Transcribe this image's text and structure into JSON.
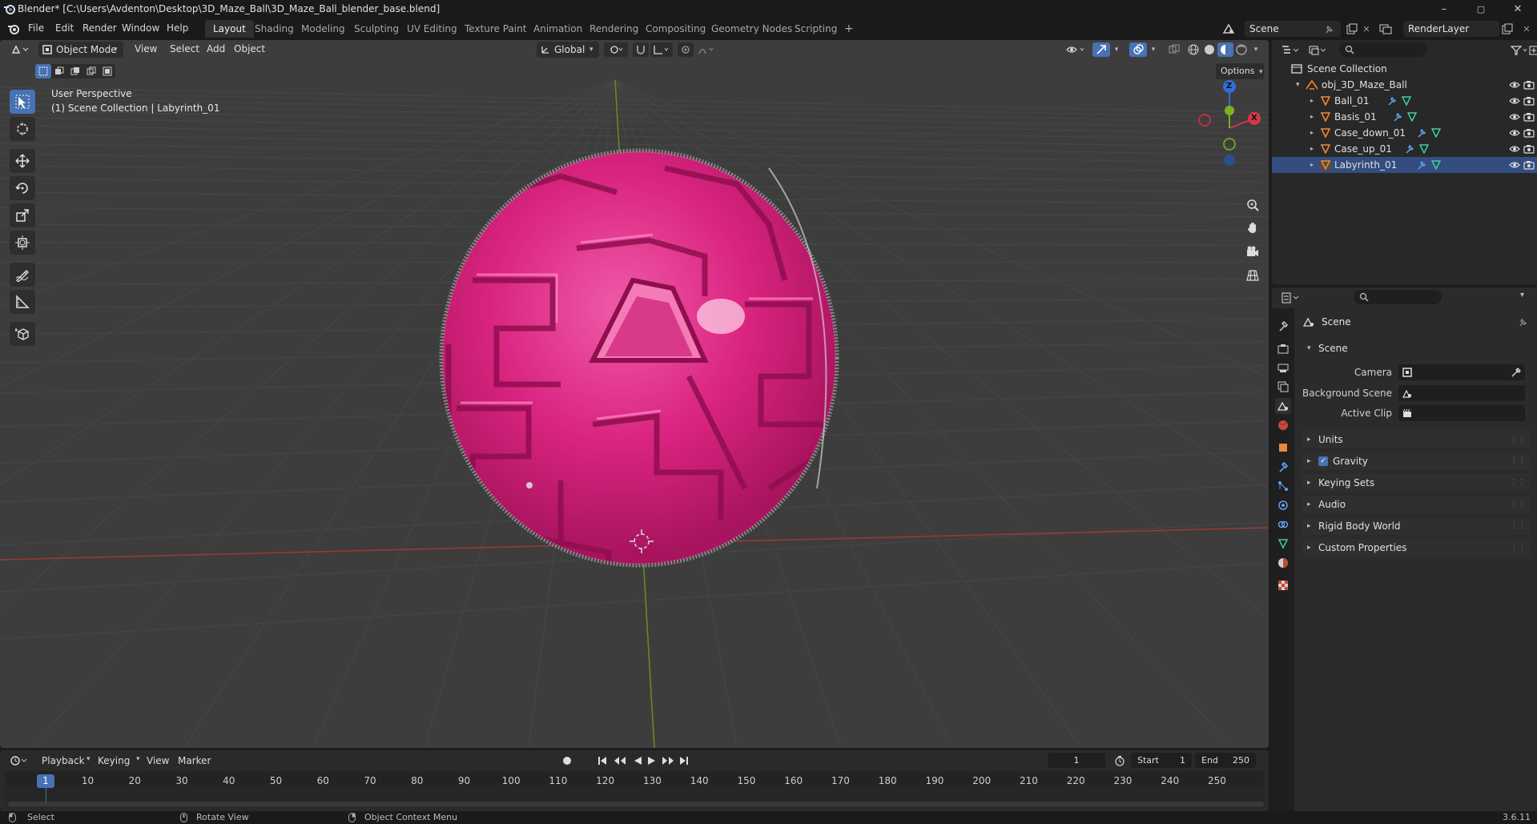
{
  "window": {
    "title": "Blender* [C:\\Users\\Avdenton\\Desktop\\3D_Maze_Ball\\3D_Maze_Ball_blender_base.blend]",
    "minimize": "–",
    "maximize": "▢",
    "close": "✕"
  },
  "menu": {
    "file": "File",
    "edit": "Edit",
    "render": "Render",
    "window": "Window",
    "help": "Help"
  },
  "workspaces": [
    "Layout",
    "Shading",
    "Modeling",
    "Sculpting",
    "UV Editing",
    "Texture Paint",
    "Animation",
    "Rendering",
    "Compositing",
    "Geometry Nodes",
    "Scripting"
  ],
  "workspace_add": "+",
  "scene_field": "Scene",
  "view_layer_field": "RenderLayer",
  "viewport": {
    "mode": "Object Mode",
    "menus": {
      "view": "View",
      "select": "Select",
      "add": "Add",
      "object": "Object"
    },
    "orientation": "Global",
    "options": "Options",
    "overlay_line1": "User Perspective",
    "overlay_line2": "(1) Scene Collection | Labyrinth_01",
    "gizmo": {
      "z": "Z",
      "x": "X"
    }
  },
  "outliner": {
    "root": "Scene Collection",
    "collection": "obj_3D_Maze_Ball",
    "objects": [
      "Ball_01",
      "Basis_01",
      "Case_down_01",
      "Case_up_01",
      "Labyrinth_01"
    ]
  },
  "properties": {
    "context": "Scene",
    "scene_panel": "Scene",
    "camera_label": "Camera",
    "background_label": "Background Scene",
    "clip_label": "Active Clip",
    "panels": [
      "Units",
      "Gravity",
      "Keying Sets",
      "Audio",
      "Rigid Body World",
      "Custom Properties"
    ]
  },
  "timeline": {
    "menus": {
      "playback": "Playback",
      "keying": "Keying",
      "view": "View",
      "marker": "Marker"
    },
    "current_frame": "1",
    "start_label": "Start",
    "start": "1",
    "end_label": "End",
    "end": "250",
    "ticks": [
      "1",
      "10",
      "20",
      "30",
      "40",
      "50",
      "60",
      "70",
      "80",
      "90",
      "100",
      "110",
      "120",
      "130",
      "140",
      "150",
      "160",
      "170",
      "180",
      "190",
      "200",
      "210",
      "220",
      "230",
      "240",
      "250"
    ]
  },
  "status": {
    "select": "Select",
    "rotate": "Rotate View",
    "context_menu": "Object Context Menu",
    "version": "3.6.11"
  },
  "colors": {
    "accent": "#4772b3",
    "sphere": "#e2278a",
    "grid": "#474747",
    "axis_x": "#9a3a3a",
    "axis_y": "#6b8c21",
    "object_icon": "#e88a3c",
    "mesh_icon": "#3fcf9d"
  }
}
